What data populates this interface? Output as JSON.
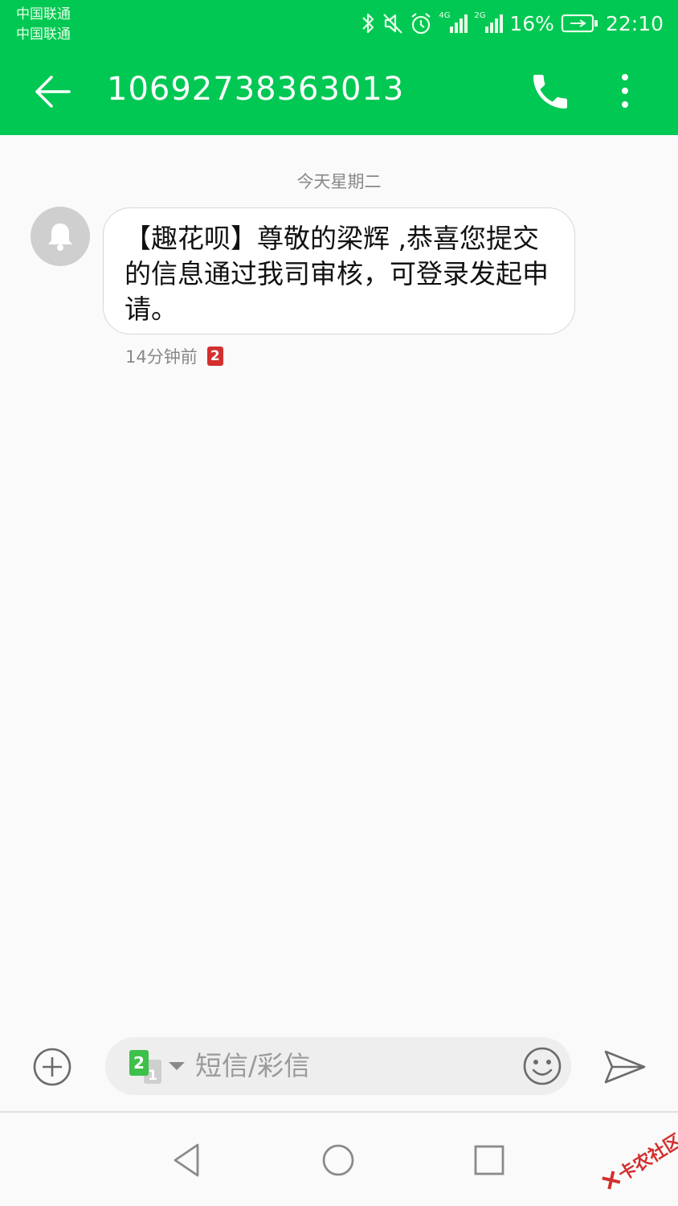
{
  "status_bar": {
    "carrier_1": "中国联通",
    "carrier_2": "中国联通",
    "battery": "16%",
    "time": "22:10",
    "sim1_network": "4G",
    "sim2_network": "2G",
    "icons": [
      "bluetooth-icon",
      "mute-icon",
      "alarm-icon",
      "signal-icon",
      "battery-icon"
    ]
  },
  "header": {
    "title": "10692738363013",
    "background_color": "#00c853"
  },
  "conversation": {
    "date_divider": "今天星期二",
    "messages": [
      {
        "text": "【趣花呗】尊敬的梁辉 ,恭喜您提交的信息通过我司审核，可登录发起申请。",
        "time": "14分钟前",
        "sim": "2"
      }
    ]
  },
  "composer": {
    "placeholder": "短信/彩信",
    "sim_active": "2",
    "sim_inactive": "1"
  },
  "nav": {
    "icons": [
      "nav-back-icon",
      "nav-home-icon",
      "nav-recent-icon"
    ]
  },
  "watermark": {
    "text": "卡农社区"
  }
}
